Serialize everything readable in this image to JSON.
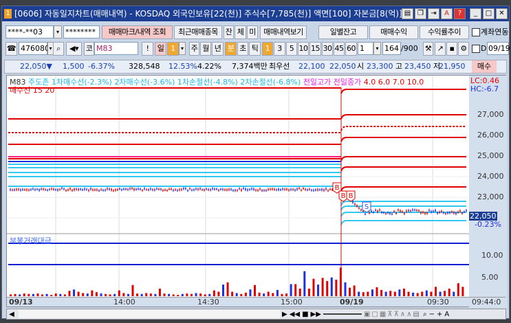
{
  "title": {
    "text": "[0606] 자동일지차트(매매내역) - KOSDAQ 외국인보유[22(천)] 주식수[7,785(천)] 액면[100] 자본금[8(억)] 결산[1",
    "badge": "1"
  },
  "toolbar1": {
    "account": "****-**03",
    "password": "********",
    "buttons": [
      "매매마크/내역 조회",
      "최근매매종목",
      "잔",
      "체",
      "미",
      "매매내역보기"
    ],
    "right_buttons": [
      "일별잔고",
      "매매수익",
      "수익률추이"
    ],
    "link_label": "계좌연동"
  },
  "toolbar2": {
    "code": "476080",
    "market": "코",
    "indicator": "M83",
    "period_types": [
      "일",
      "1",
      "주",
      "월",
      "년",
      "분",
      "초",
      "틱"
    ],
    "minutes": [
      "1",
      "3",
      "5",
      "10",
      "15",
      "30",
      "45",
      "60"
    ],
    "unit": "1",
    "count": "164",
    "total": "/900",
    "date_label": "D",
    "date": "09/19"
  },
  "quote": {
    "price": "22,050",
    "arrow": "▼",
    "change": "1,500",
    "rate": "-6.37%",
    "volume": "328,548",
    "ratio1": "12.53%",
    "ratio2": "4.22%",
    "amount": "7,374백만",
    "best_label": "최우선",
    "ask": "22,100",
    "bid": "22,050",
    "open_label": "시",
    "open": "23,300",
    "high_label": "고",
    "high": "23,450",
    "low_label": "저",
    "low": "21,950",
    "buy_label": "매수"
  },
  "price_pane": {
    "legend": [
      "M83",
      "주도존",
      "1차매수선(-2.3%)",
      "2차매수선(-3.6%)",
      "1차손절선(-4.8%)",
      "2차손절선(-6.8%)",
      "전일고가",
      "전일종가",
      "4.0",
      "6.0",
      "7.0",
      "10.0",
      "매수선",
      "15",
      "20"
    ],
    "lc": "LC:0.46",
    "hc": "HC:-6.7",
    "ticks": [
      "27,000",
      "26,000",
      "25,000",
      "24,000",
      "23,000"
    ],
    "current_price": "22,050",
    "current_rate": "-0.23%",
    "markers": [
      "B",
      "B",
      "B",
      "S"
    ]
  },
  "volume_pane": {
    "legend": "부봉거래대금",
    "ticks": [
      "10.00",
      "5.00"
    ],
    "values": [
      0.4,
      0.5,
      0.4,
      0.6,
      0.5,
      0.5,
      0.6,
      0.4,
      0.5,
      0.3,
      0.6,
      0.5,
      0.4,
      1.2,
      1.5,
      1.0,
      0.7,
      0.6,
      1.3,
      0.9,
      0.6,
      0.5,
      0.4,
      0.5,
      1.3,
      0.7,
      0.5,
      2.5,
      0.6,
      0.5,
      0.7,
      0.6,
      0.5,
      1.7,
      0.6,
      0.5,
      0.4,
      0.3,
      0.5,
      0.6,
      0.5,
      0.7,
      0.6,
      0.4,
      0.5,
      1.3,
      1.0,
      2.6,
      3.1,
      1.0,
      0.7,
      0.5,
      0.8,
      1.5,
      2.5,
      0.8,
      0.6,
      1.0,
      0.7,
      1.4,
      0.5,
      0.6,
      2.7,
      2.7,
      1.7,
      5.6,
      1.7,
      3.9,
      2.6,
      4.1,
      3.4,
      4.2,
      3.7,
      6.4,
      3.1,
      1.9,
      2.4,
      1.0,
      0.9,
      1.0,
      1.5,
      2.0,
      1.4,
      1.0,
      1.2,
      1.0,
      1.5,
      1.7,
      1.0,
      0.8,
      0.7,
      1.0,
      1.3,
      1.0,
      2.1,
      1.0,
      1.2,
      1.7,
      1.0,
      2.9,
      2.1
    ],
    "colors": [
      "#e00000",
      "#1e2fe0"
    ]
  },
  "time_axis": [
    "09/13",
    "14:00",
    "14:30",
    "15:00",
    "09/19",
    "09:30",
    "09:44:0"
  ],
  "colors": {
    "up": "#e00000",
    "down": "#1e2fe0",
    "buy_line": "#2ec8f0",
    "stop_line": "#e00000",
    "title_bar": "#1c3f94"
  }
}
